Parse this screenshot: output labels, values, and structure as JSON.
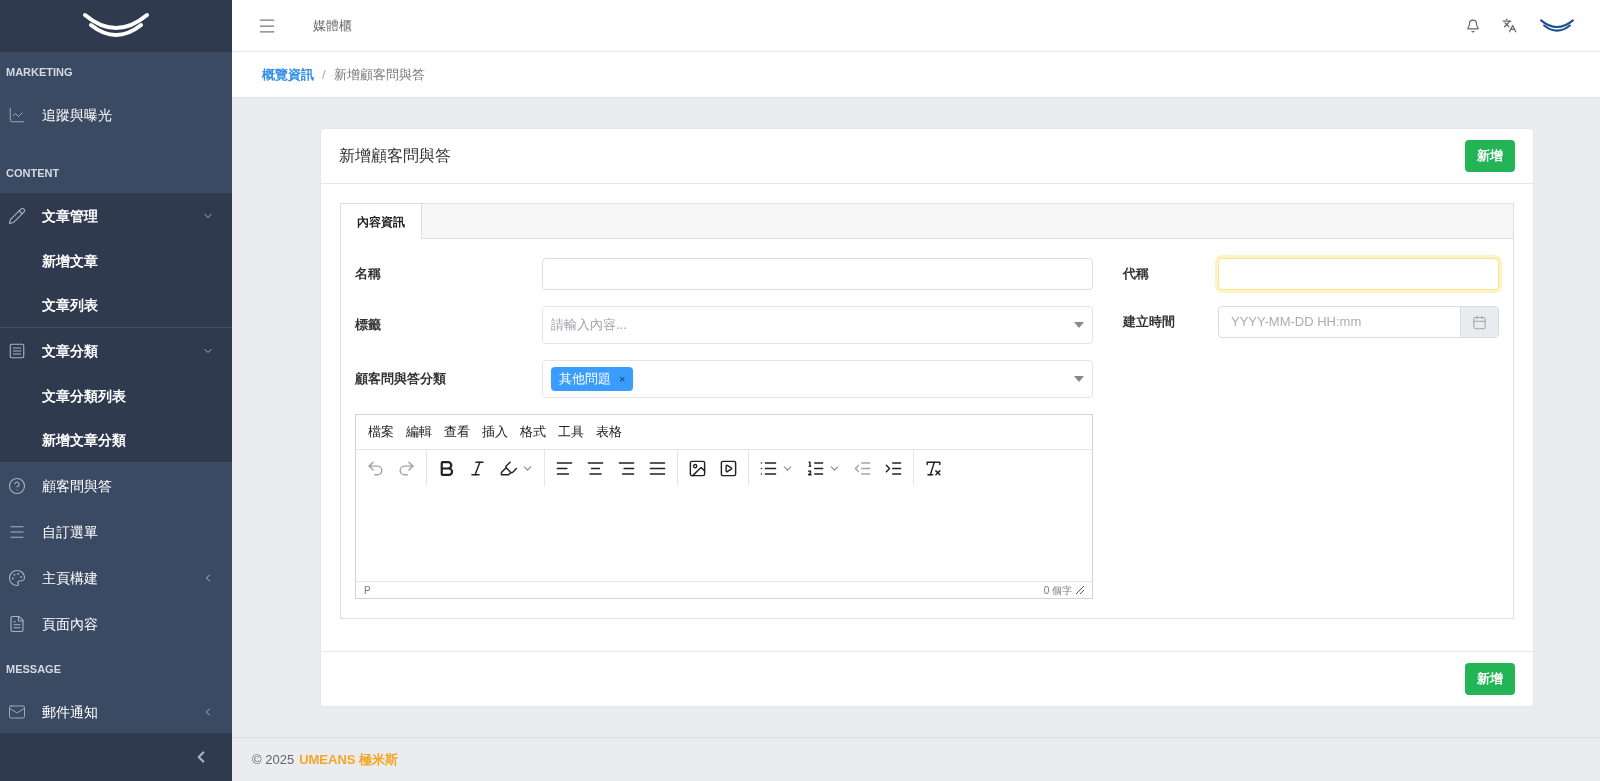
{
  "sidebar": {
    "sections": [
      {
        "title": "MARKETING",
        "items": [
          {
            "label": "追蹤與曝光"
          }
        ]
      },
      {
        "title": "CONTENT",
        "items": [
          {
            "label": "文章管理",
            "expanded": true,
            "children": [
              {
                "label": "新增文章"
              },
              {
                "label": "文章列表"
              }
            ]
          },
          {
            "label": "文章分類",
            "expanded": true,
            "children": [
              {
                "label": "文章分類列表"
              },
              {
                "label": "新增文章分類"
              }
            ]
          },
          {
            "label": "顧客問與答"
          },
          {
            "label": "自訂選單"
          },
          {
            "label": "主頁構建",
            "expanded": false
          },
          {
            "label": "頁面內容"
          }
        ]
      },
      {
        "title": "MESSAGE",
        "items": [
          {
            "label": "郵件通知",
            "expanded": false
          }
        ]
      }
    ]
  },
  "header": {
    "title": "媒體櫃"
  },
  "breadcrumb": [
    {
      "label": "概覽資訊",
      "link": true
    },
    {
      "label": "新增顧客問與答",
      "link": false
    }
  ],
  "breadcrumb_separator": "/",
  "card": {
    "title": "新增顧客問與答",
    "top_button": "新增",
    "bottom_button": "新增",
    "tabs": [
      {
        "label": "內容資訊",
        "selected": true
      }
    ],
    "left_fields": [
      {
        "kind": "text",
        "label": "名稱",
        "focused": false
      },
      {
        "kind": "select",
        "label": "標籤",
        "placeholder": "請輸入內容..."
      },
      {
        "kind": "tags",
        "label": "顧客問與答分類",
        "tags": [
          "其他問題"
        ],
        "remove": "×"
      }
    ],
    "right_fields": [
      {
        "kind": "text",
        "label": "代稱",
        "focused": true
      },
      {
        "kind": "date",
        "label": "建立時間",
        "placeholder": "YYYY-MM-DD HH:mm"
      }
    ],
    "editor": {
      "menu": [
        "檔案",
        "編輯",
        "查看",
        "插入",
        "格式",
        "工具",
        "表格"
      ],
      "toolbar_groups": [
        [
          {
            "disabled": true
          },
          {
            "disabled": true
          }
        ],
        [
          {
            "disabled": false
          },
          {
            "disabled": false
          },
          {
            "disabled": false
          }
        ],
        [
          {
            "disabled": false
          },
          {
            "disabled": false
          },
          {
            "disabled": false
          },
          {
            "disabled": false
          }
        ],
        [
          {
            "disabled": false
          },
          {
            "disabled": false
          }
        ],
        [
          {
            "disabled": false
          },
          {
            "disabled": false
          },
          {
            "disabled": true
          },
          {
            "disabled": false
          }
        ],
        [
          {
            "disabled": false
          }
        ]
      ],
      "path": "P",
      "word_count": "0 個字"
    }
  },
  "footer": {
    "copyright": "© 2025",
    "brand": "UMEANS 極米斯"
  }
}
